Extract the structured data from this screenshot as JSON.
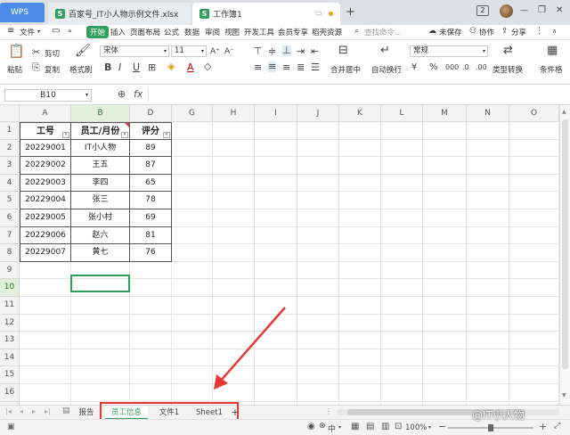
{
  "titlebar": {
    "wps_label": "WPS",
    "tabs": [
      {
        "label": "百家号_IT小人物示例文件.xlsx",
        "active": false
      },
      {
        "label": "工作簿1",
        "active": true
      }
    ],
    "add_tab": "+",
    "badge": "2",
    "window_controls": [
      "—",
      "❐",
      "✕"
    ]
  },
  "menubar": {
    "file_menu": "文件",
    "items": [
      "开始",
      "插入",
      "页面布局",
      "公式",
      "数据",
      "审阅",
      "视图",
      "开发工具",
      "会员专享",
      "稻壳资源"
    ],
    "active_item": "开始",
    "search_placeholder": "查找命令...",
    "right_items": [
      "未保存",
      "协作",
      "分享"
    ]
  },
  "ribbon": {
    "paste": "粘贴",
    "cut": "剪切",
    "copy": "复制",
    "format_painter": "格式刷",
    "font_name": "宋体",
    "font_size": "11",
    "bold": "B",
    "italic": "I",
    "underline": "U",
    "merge_center": "合并居中",
    "wrap_text": "自动换行",
    "number_format": "常规",
    "type_convert": "类型转换",
    "conditional": "条件格"
  },
  "formula_bar": {
    "name_box": "B10",
    "fx": "fx",
    "value": ""
  },
  "grid": {
    "columns": [
      "A",
      "B",
      "D",
      "G",
      "H",
      "I",
      "J",
      "K",
      "L",
      "M",
      "N",
      "O"
    ],
    "rows": [
      "1",
      "2",
      "3",
      "4",
      "5",
      "6",
      "7",
      "8",
      "9",
      "10",
      "11",
      "12",
      "13",
      "14",
      "15",
      "16",
      "17"
    ],
    "active_cell": "B10",
    "header": {
      "a": "工号",
      "b": "员工/月份",
      "d": "评分"
    },
    "data": [
      {
        "id": "20229001",
        "name": "IT小人物",
        "score": "89"
      },
      {
        "id": "20229002",
        "name": "王五",
        "score": "87"
      },
      {
        "id": "20229003",
        "name": "李四",
        "score": "65"
      },
      {
        "id": "20229004",
        "name": "张三",
        "score": "78"
      },
      {
        "id": "20229005",
        "name": "张小村",
        "score": "69"
      },
      {
        "id": "20229006",
        "name": "赵六",
        "score": "81"
      },
      {
        "id": "20229007",
        "name": "黄七",
        "score": "76"
      }
    ]
  },
  "sheet_tabs": {
    "tabs": [
      "报告",
      "员工信息",
      "文件1",
      "Sheet1"
    ],
    "active": "员工信息",
    "add": "+"
  },
  "status_bar": {
    "zoom": "100%",
    "ime": "中",
    "watermark": "@IT小人物"
  },
  "colors": {
    "accent": "#2fa05a",
    "annotation": "#e53935",
    "tabbar": "#dde1e6"
  }
}
